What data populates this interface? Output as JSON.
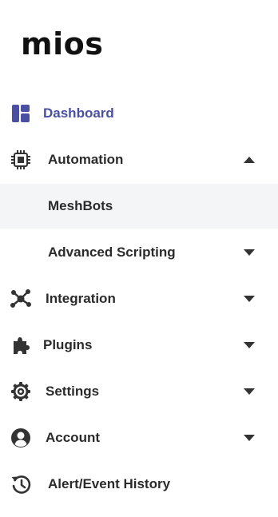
{
  "brand": {
    "logo_text": "mios"
  },
  "colors": {
    "active": "#4a4fa3",
    "text": "#2b2b2b",
    "selected_bg": "#f4f5f7"
  },
  "nav": {
    "dashboard": {
      "label": "Dashboard",
      "icon": "dashboard-icon"
    },
    "automation": {
      "label": "Automation",
      "icon": "automation-chip-icon",
      "expanded": true
    },
    "meshbots": {
      "label": "MeshBots"
    },
    "advanced_scripting": {
      "label": "Advanced Scripting"
    },
    "integration": {
      "label": "Integration",
      "icon": "integration-hub-icon"
    },
    "plugins": {
      "label": "Plugins",
      "icon": "puzzle-piece-icon"
    },
    "settings": {
      "label": "Settings",
      "icon": "gear-icon"
    },
    "account": {
      "label": "Account",
      "icon": "user-circle-icon"
    },
    "history": {
      "label": "Alert/Event History",
      "icon": "history-icon"
    }
  }
}
